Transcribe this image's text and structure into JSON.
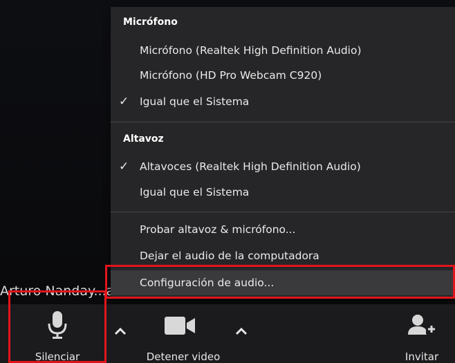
{
  "participant_name": "Arturo Nanday...ana Parada",
  "audio_menu": {
    "microphone_header": "Micrófono",
    "microphone_options": [
      {
        "label": "Micrófono (Realtek High Definition Audio)",
        "checked": false
      },
      {
        "label": "Micrófono (HD Pro Webcam C920)",
        "checked": false
      },
      {
        "label": "Igual que el Sistema",
        "checked": true
      }
    ],
    "speaker_header": "Altavoz",
    "speaker_options": [
      {
        "label": "Altavoces (Realtek High Definition Audio)",
        "checked": true
      },
      {
        "label": "Igual que el Sistema",
        "checked": false
      }
    ],
    "actions": [
      {
        "label": "Probar altavoz & micrófono..."
      },
      {
        "label": "Dejar el audio de la computadora"
      },
      {
        "label": "Configuración de audio..."
      }
    ],
    "check_glyph": "✓"
  },
  "toolbar": {
    "mute_label": "Silenciar",
    "video_label": "Detener video",
    "invite_label": "Invitar"
  },
  "icons": [
    "microphone-icon",
    "caret-up-icon",
    "video-camera-icon",
    "add-user-icon"
  ],
  "colors": {
    "highlight": "#e2141c",
    "menu_bg": "#262628",
    "toolbar_bg": "#1b1b1d"
  }
}
